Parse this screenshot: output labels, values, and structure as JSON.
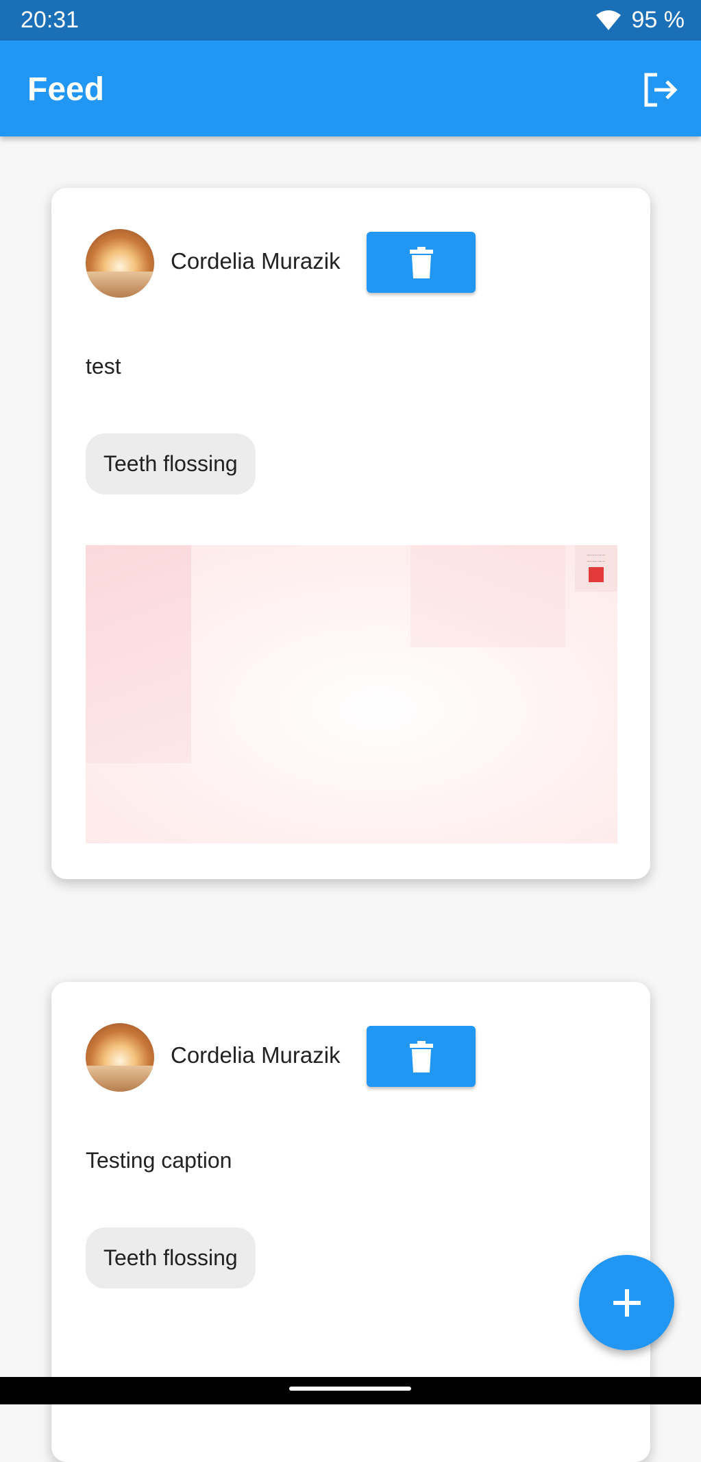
{
  "status_bar": {
    "time": "20:31",
    "battery": "95 %"
  },
  "app_bar": {
    "title": "Feed",
    "logout_icon": "logout-icon"
  },
  "posts": [
    {
      "author": "Cordelia Murazik",
      "caption": "test",
      "tag": "Teeth flossing"
    },
    {
      "author": "Cordelia Murazik",
      "caption": "Testing caption",
      "tag": "Teeth flossing"
    }
  ],
  "fab": {
    "icon": "plus-icon"
  },
  "colors": {
    "primary": "#2196f3",
    "status_bar": "#1b6fb7"
  }
}
